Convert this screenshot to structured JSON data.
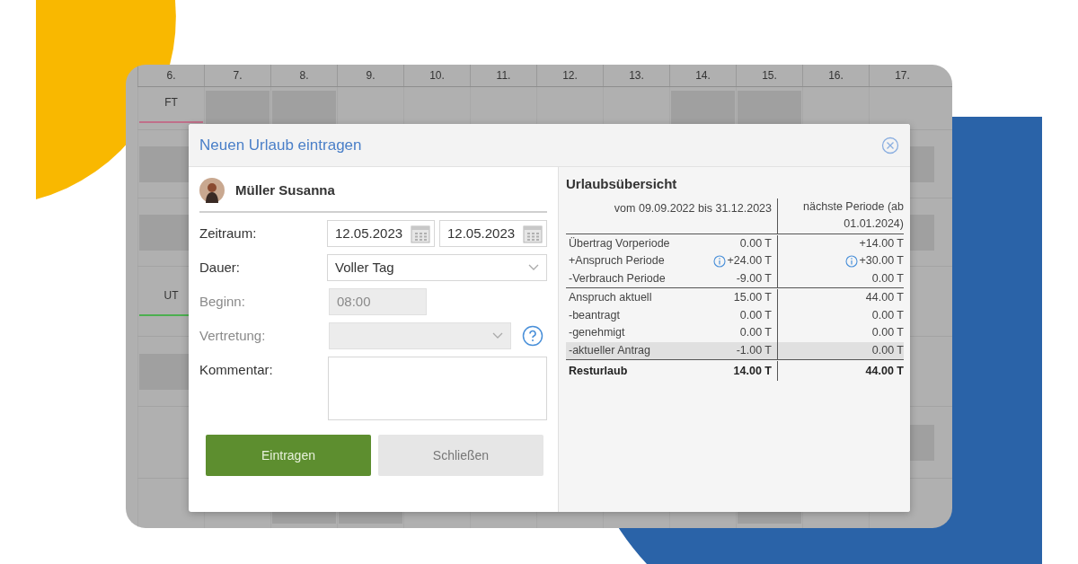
{
  "calendar": {
    "days": [
      "6.",
      "7.",
      "8.",
      "9.",
      "10.",
      "11.",
      "12.",
      "13.",
      "14.",
      "15.",
      "16.",
      "17."
    ],
    "row_labels": [
      {
        "label": "FT",
        "color": "#c0708a"
      },
      {
        "label": "UT",
        "color": "#4caf50"
      }
    ]
  },
  "dialog": {
    "title": "Neuen Urlaub eintragen",
    "employee": "Müller Susanna",
    "fields": [
      {
        "kind": "date_range",
        "label": "Zeitraum:",
        "disabled": false,
        "values": [
          "12.05.2023",
          "12.05.2023"
        ]
      },
      {
        "kind": "select",
        "label": "Dauer:",
        "disabled": false,
        "value": "Voller Tag"
      },
      {
        "kind": "time",
        "label": "Beginn:",
        "disabled": true,
        "value": "08:00"
      },
      {
        "kind": "select",
        "label": "Vertretung:",
        "disabled": true,
        "help": true
      },
      {
        "kind": "textarea",
        "label": "Kommentar:",
        "disabled": false
      }
    ],
    "buttons": [
      {
        "kind": "primary",
        "label": "Eintragen"
      },
      {
        "kind": "secondary",
        "label": "Schließen"
      }
    ],
    "overview": {
      "title": "Urlaubsübersicht",
      "columns": [
        "vom 09.09.2022 bis 31.12.2023",
        "nächste Periode (ab 01.01.2024)"
      ],
      "sections": [
        {
          "rows": [
            {
              "label": "Übertrag Vorperiode",
              "highlighted": false,
              "total": false,
              "values": [
                {
                  "text": "0.00 T",
                  "info": false
                },
                {
                  "text": "+14.00 T",
                  "info": false
                }
              ]
            },
            {
              "label": "+Anspruch Periode",
              "highlighted": false,
              "total": false,
              "values": [
                {
                  "text": "+24.00 T",
                  "info": true
                },
                {
                  "text": "+30.00 T",
                  "info": true
                }
              ]
            },
            {
              "label": "-Verbrauch Periode",
              "highlighted": false,
              "total": false,
              "values": [
                {
                  "text": "-9.00 T",
                  "info": false
                },
                {
                  "text": "0.00 T",
                  "info": false
                }
              ]
            }
          ]
        },
        {
          "rows": [
            {
              "label": "Anspruch aktuell",
              "highlighted": false,
              "total": false,
              "values": [
                {
                  "text": "15.00 T",
                  "info": false
                },
                {
                  "text": "44.00 T",
                  "info": false
                }
              ]
            },
            {
              "label": "-beantragt",
              "highlighted": false,
              "total": false,
              "values": [
                {
                  "text": "0.00 T",
                  "info": false
                },
                {
                  "text": "0.00 T",
                  "info": false
                }
              ]
            },
            {
              "label": "-genehmigt",
              "highlighted": false,
              "total": false,
              "values": [
                {
                  "text": "0.00 T",
                  "info": false
                },
                {
                  "text": "0.00 T",
                  "info": false
                }
              ]
            },
            {
              "label": "-aktueller Antrag",
              "highlighted": true,
              "total": false,
              "values": [
                {
                  "text": "-1.00 T",
                  "info": false
                },
                {
                  "text": "0.00 T",
                  "info": false
                }
              ]
            }
          ]
        },
        {
          "rows": [
            {
              "label": "Resturlaub",
              "highlighted": false,
              "total": true,
              "values": [
                {
                  "text": "14.00 T",
                  "info": false
                },
                {
                  "text": "44.00 T",
                  "info": false
                }
              ]
            }
          ]
        }
      ]
    }
  }
}
